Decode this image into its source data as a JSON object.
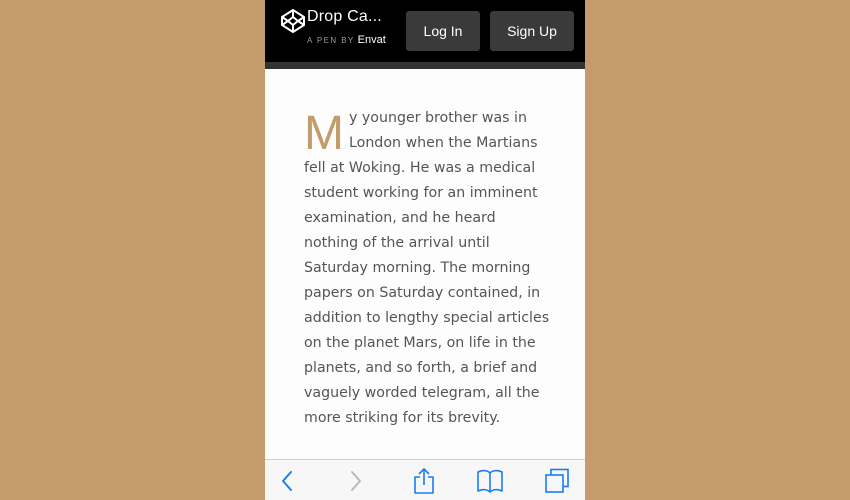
{
  "header": {
    "brand_title": "Drop Ca...",
    "pen_by": "A PEN BY",
    "vendor": "Envat",
    "login_label": "Log In",
    "signup_label": "Sign Up"
  },
  "article": {
    "drop_cap": "M",
    "text": "y younger brother was in London when the Martians fell at Woking. He was a medical student working for an imminent examination, and he heard nothing of the arrival until Saturday morning. The morning papers on Saturday contained, in addition to lengthy special articles on the planet Mars, on life in the planets, and so forth, a brief and vaguely worded telegram, all the more striking for its brevity."
  },
  "toolbar": {
    "icons": [
      "back-icon",
      "forward-icon",
      "share-icon",
      "bookmarks-icon",
      "tabs-icon"
    ]
  },
  "colors": {
    "page_background": "#c49b6b",
    "drop_cap": "#c49b6b",
    "header_background": "#000000",
    "button_background": "#3a3a3a",
    "toolbar_icon": "#1a7cf5"
  }
}
